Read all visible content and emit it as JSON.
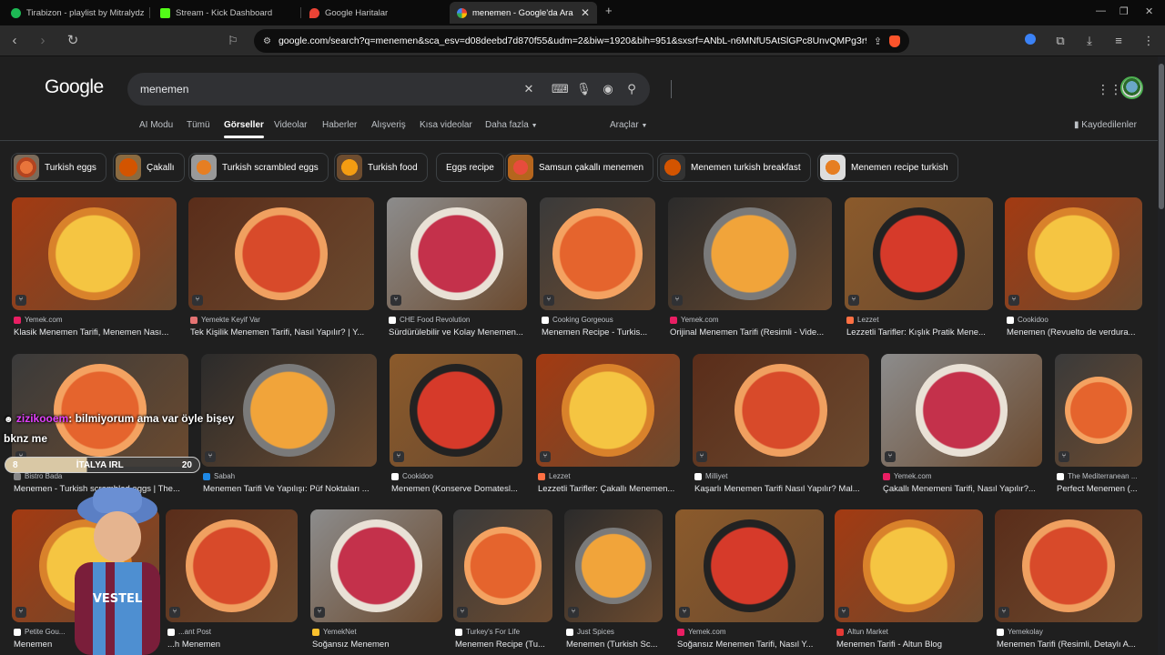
{
  "tabs": [
    {
      "title": "Tirabizon - playlist by Mitralydz | Spo",
      "color": "#1db954"
    },
    {
      "title": "Stream - Kick Dashboard",
      "color": "#53fc18"
    },
    {
      "title": "Google Haritalar",
      "color": "#34a853"
    },
    {
      "title": "menemen - Google'da Ara",
      "color": "#4285f4"
    }
  ],
  "address": {
    "url": "google.com/search?q=menemen&sca_esv=d08deebd7d870f55&udm=2&biw=1920&bih=951&sxsrf=ANbL-n6MNfU5AtSlGPc8UnvQMPg3r9FS..."
  },
  "google": {
    "logo": "Google",
    "query": "menemen"
  },
  "nav": {
    "tabs": [
      "AI Modu",
      "Tümü",
      "Görseller",
      "Videolar",
      "Haberler",
      "Alışveriş",
      "Kısa videolar",
      "Daha fazla"
    ],
    "tools": "Araçlar",
    "saved": "Kaydedilenler"
  },
  "chips": [
    "Turkish eggs",
    "Çakallı",
    "Turkish scrambled eggs",
    "Turkish food",
    "Eggs recipe",
    "Samsun çakallı menemen",
    "Menemen turkish breakfast",
    "Menemen recipe turkish"
  ],
  "results": [
    [
      {
        "source": "Yemek.com",
        "title": "Klasik Menemen Tarifi, Menemen Nası...",
        "src_color": "#e91e63"
      },
      {
        "source": "Yemekte Keyif Var",
        "title": "Tek Kişilik Menemen Tarifi, Nasıl Yapılır? | Y...",
        "src_color": "#e57373"
      },
      {
        "source": "CHE Food Revolution",
        "title": "Sürdürülebilir ve Kolay Menemen...",
        "src_color": "#ffffff"
      },
      {
        "source": "Cooking Gorgeous",
        "title": "Menemen Recipe - Turkis...",
        "src_color": "#ffffff"
      },
      {
        "source": "Yemek.com",
        "title": "Orijinal Menemen Tarifi (Resimli - Vide...",
        "src_color": "#e91e63"
      },
      {
        "source": "Lezzet",
        "title": "Lezzetli Tarifler: Kışlık Pratik Mene...",
        "src_color": "#ff7043"
      },
      {
        "source": "Cookidoo",
        "title": "Menemen (Revuelto de verdura...",
        "src_color": "#ffffff"
      }
    ],
    [
      {
        "source": "Bistro Bada",
        "title": "Menemen - Turkish scrambled eggs | The...",
        "src_color": "#888888"
      },
      {
        "source": "Sabah",
        "title": "Menemen Tarifi Ve Yapılışı: Püf Noktaları ...",
        "src_color": "#1e88e5"
      },
      {
        "source": "Cookidoo",
        "title": "Menemen (Konserve Domatesl...",
        "src_color": "#ffffff"
      },
      {
        "source": "Lezzet",
        "title": "Lezzetli Tarifler: Çakallı Menemen...",
        "src_color": "#ff7043"
      },
      {
        "source": "Milliyet",
        "title": "Kaşarlı Menemen Tarifi Nasıl Yapılır? Mal...",
        "src_color": "#ffffff"
      },
      {
        "source": "Yemek.com",
        "title": "Çakallı Menemeni Tarifi, Nasıl Yapılır?...",
        "src_color": "#e91e63"
      },
      {
        "source": "The Mediterranean ...",
        "title": "Perfect Menemen (...",
        "src_color": "#ffffff"
      }
    ],
    [
      {
        "source": "Petite Gou...",
        "title": "Menemen",
        "src_color": "#ffffff"
      },
      {
        "source": "...ant Post",
        "title": "...h Menemen",
        "src_color": "#ffffff"
      },
      {
        "source": "YemekNet",
        "title": "Soğansız Menemen",
        "src_color": "#fbc02d"
      },
      {
        "source": "Turkey's For Life",
        "title": "Menemen Recipe (Tu...",
        "src_color": "#ffffff"
      },
      {
        "source": "Just Spices",
        "title": "Menemen (Turkish Sc...",
        "src_color": "#ffffff"
      },
      {
        "source": "Yemek.com",
        "title": "Soğansız Menemen Tarifi, Nasıl Y...",
        "src_color": "#e91e63"
      },
      {
        "source": "Altun Market",
        "title": "Menemen Tarifi - Altun Blog",
        "src_color": "#e53935"
      },
      {
        "source": "Yemekolay",
        "title": "Menemen Tarifi (Resimli, Detaylı A...",
        "src_color": "#ffffff"
      }
    ]
  ],
  "overlay": {
    "chat_user": "zizikooem",
    "chat_message": ": bilmiyorum ama var öyle bişey",
    "chat_message2": "bknz me",
    "bar_left": "8",
    "bar_label": "İTALYA IRL",
    "bar_right": "20"
  }
}
